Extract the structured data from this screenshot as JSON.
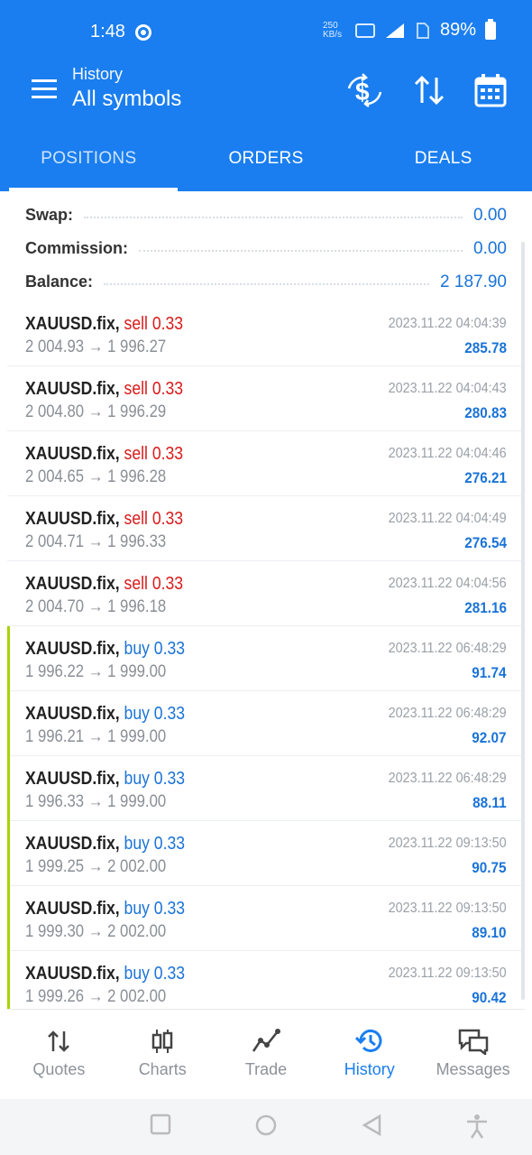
{
  "status_bar": {
    "time": "1:48",
    "net_speed": "250 KB/s",
    "battery": "89%"
  },
  "header": {
    "subtitle": "History",
    "title": "All symbols",
    "icons": [
      "currency-exchange-icon",
      "sort-icon",
      "calendar-icon"
    ]
  },
  "tabs": [
    {
      "label": "POSITIONS",
      "active": true
    },
    {
      "label": "ORDERS",
      "active": false
    },
    {
      "label": "DEALS",
      "active": false
    }
  ],
  "summary": {
    "swap_label": "Swap:",
    "swap_value": "0.00",
    "commission_label": "Commission:",
    "commission_value": "0.00",
    "balance_label": "Balance:",
    "balance_value": "2 187.90"
  },
  "deals": [
    {
      "symbol": "XAUUSD.fix,",
      "side": "sell 0.33",
      "type": "sell",
      "prices": "2 004.93 → 1 996.27",
      "time": "2023.11.22 04:04:39",
      "profit": "285.78"
    },
    {
      "symbol": "XAUUSD.fix,",
      "side": "sell 0.33",
      "type": "sell",
      "prices": "2 004.80 → 1 996.29",
      "time": "2023.11.22 04:04:43",
      "profit": "280.83"
    },
    {
      "symbol": "XAUUSD.fix,",
      "side": "sell 0.33",
      "type": "sell",
      "prices": "2 004.65 → 1 996.28",
      "time": "2023.11.22 04:04:46",
      "profit": "276.21"
    },
    {
      "symbol": "XAUUSD.fix,",
      "side": "sell 0.33",
      "type": "sell",
      "prices": "2 004.71 → 1 996.33",
      "time": "2023.11.22 04:04:49",
      "profit": "276.54"
    },
    {
      "symbol": "XAUUSD.fix,",
      "side": "sell 0.33",
      "type": "sell",
      "prices": "2 004.70 → 1 996.18",
      "time": "2023.11.22 04:04:56",
      "profit": "281.16"
    },
    {
      "symbol": "XAUUSD.fix,",
      "side": "buy 0.33",
      "type": "buy",
      "prices": "1 996.22 → 1 999.00",
      "time": "2023.11.22 06:48:29",
      "profit": "91.74"
    },
    {
      "symbol": "XAUUSD.fix,",
      "side": "buy 0.33",
      "type": "buy",
      "prices": "1 996.21 → 1 999.00",
      "time": "2023.11.22 06:48:29",
      "profit": "92.07"
    },
    {
      "symbol": "XAUUSD.fix,",
      "side": "buy 0.33",
      "type": "buy",
      "prices": "1 996.33 → 1 999.00",
      "time": "2023.11.22 06:48:29",
      "profit": "88.11"
    },
    {
      "symbol": "XAUUSD.fix,",
      "side": "buy 0.33",
      "type": "buy",
      "prices": "1 999.25 → 2 002.00",
      "time": "2023.11.22 09:13:50",
      "profit": "90.75"
    },
    {
      "symbol": "XAUUSD.fix,",
      "side": "buy 0.33",
      "type": "buy",
      "prices": "1 999.30 → 2 002.00",
      "time": "2023.11.22 09:13:50",
      "profit": "89.10"
    },
    {
      "symbol": "XAUUSD.fix,",
      "side": "buy 0.33",
      "type": "buy",
      "prices": "1 999.26 → 2 002.00",
      "time": "2023.11.22 09:13:50",
      "profit": "90.42"
    }
  ],
  "bottom_nav": [
    {
      "label": "Quotes",
      "icon": "quotes-icon",
      "active": false
    },
    {
      "label": "Charts",
      "icon": "charts-icon",
      "active": false
    },
    {
      "label": "Trade",
      "icon": "trade-icon",
      "active": false
    },
    {
      "label": "History",
      "icon": "history-icon",
      "active": true
    },
    {
      "label": "Messages",
      "icon": "messages-icon",
      "active": false
    }
  ],
  "colors": {
    "primary": "#1a7ef0",
    "sell": "#d91b1b",
    "buy": "#1a73d8",
    "buy_marker": "#a8d400"
  }
}
